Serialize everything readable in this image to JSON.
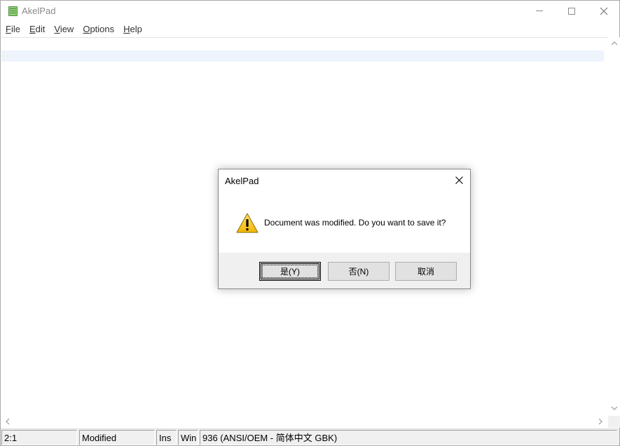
{
  "window": {
    "title": "AkelPad",
    "controls": {
      "minimize": "minimize",
      "maximize": "maximize",
      "close": "close"
    }
  },
  "menu": {
    "items": [
      {
        "label": "File",
        "accel": "F"
      },
      {
        "label": "Edit",
        "accel": "E"
      },
      {
        "label": "View",
        "accel": "V"
      },
      {
        "label": "Options",
        "accel": "O"
      },
      {
        "label": "Help",
        "accel": "H"
      }
    ]
  },
  "statusbar": {
    "position": "2:1",
    "modified": "Modified",
    "insert_mode": "Ins",
    "newline": "Win",
    "codepage": "936   (ANSI/OEM - 简体中文 GBK)"
  },
  "dialog": {
    "title": "AkelPad",
    "icon": "warning-icon",
    "message": "Document was modified. Do you want to save it?",
    "buttons": {
      "yes": "是(Y)",
      "no": "否(N)",
      "cancel": "取消"
    }
  },
  "colors": {
    "current_line": "#eef4fb",
    "dialog_footer": "#f0f0f0",
    "warning_yellow": "#f5c518"
  }
}
